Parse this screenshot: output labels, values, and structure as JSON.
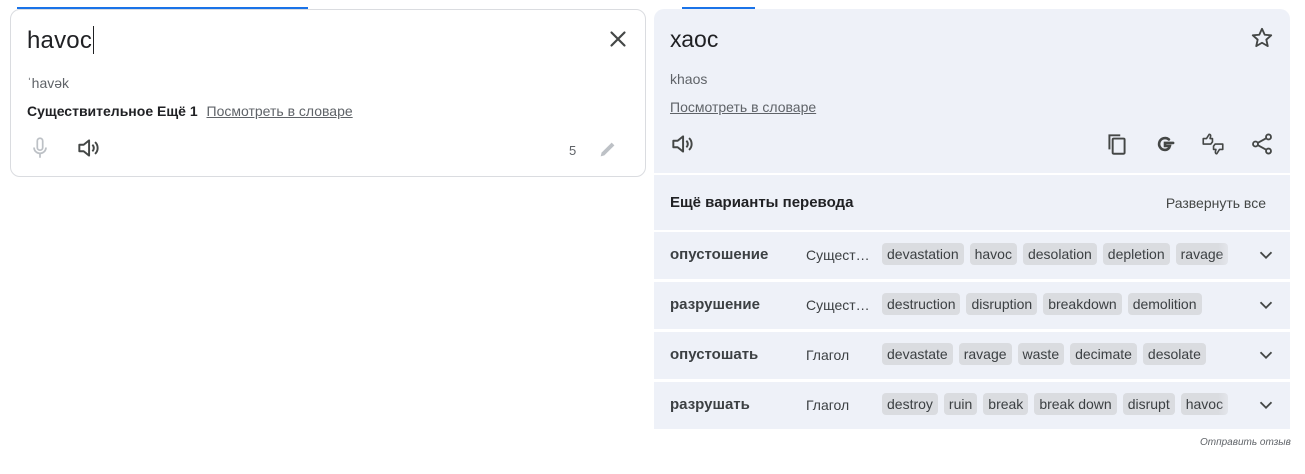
{
  "source": {
    "text": "havoc",
    "transliteration": "ˈhavək",
    "pos_label": "Существительное Ещё 1",
    "dictionary_link": "Посмотреть в словаре",
    "char_count": "5",
    "icons": {
      "clear": "close-icon",
      "mic": "microphone-icon",
      "speaker": "speaker-icon",
      "edit": "pencil-icon"
    }
  },
  "target": {
    "text": "хаос",
    "transliteration": "khaos",
    "dictionary_link": "Посмотреть в словаре",
    "icons": {
      "star": "star-icon",
      "speaker": "speaker-icon",
      "copy": "copy-icon",
      "google": "google-icon",
      "feedback": "rate-translation-icon",
      "share": "share-icon"
    }
  },
  "more_translations": {
    "title": "Ещё варианты перевода",
    "expand_all": "Развернуть все",
    "rows": [
      {
        "word": "опустошение",
        "pos": "Существительное",
        "pos_display": "Сущест…",
        "synonyms": [
          "devastation",
          "havoc",
          "desolation",
          "depletion",
          "ravage"
        ]
      },
      {
        "word": "разрушение",
        "pos": "Существительное",
        "pos_display": "Сущест…",
        "synonyms": [
          "destruction",
          "disruption",
          "breakdown",
          "demolition"
        ]
      },
      {
        "word": "опустошать",
        "pos": "Глагол",
        "pos_display": "Глагол",
        "synonyms": [
          "devastate",
          "ravage",
          "waste",
          "decimate",
          "desolate"
        ]
      },
      {
        "word": "разрушать",
        "pos": "Глагол",
        "pos_display": "Глагол",
        "synonyms": [
          "destroy",
          "ruin",
          "break",
          "break down",
          "disrupt",
          "havoc"
        ]
      }
    ]
  },
  "feedback": "Отправить отзыв",
  "colors": {
    "accent": "#1a73e8",
    "target_bg": "#eef1f8",
    "chip_bg": "#dadce0",
    "icon": "#444746"
  }
}
